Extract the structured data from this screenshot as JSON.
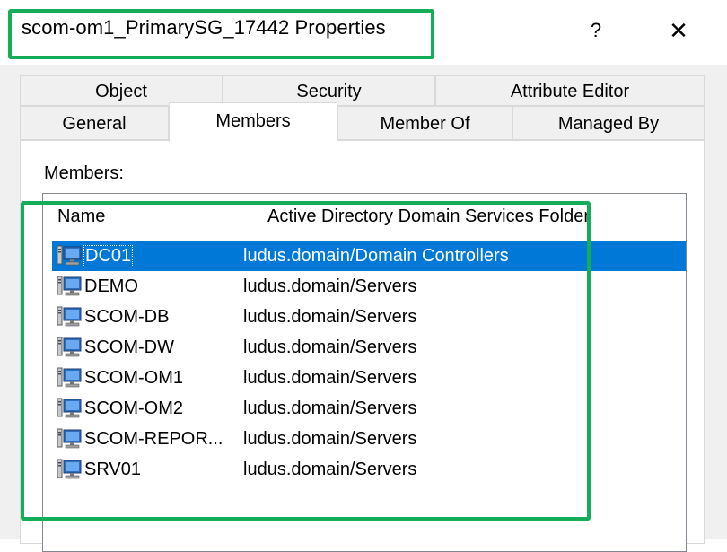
{
  "window": {
    "title": "scom-om1_PrimarySG_17442 Properties",
    "help_label": "?",
    "close_label": "✕"
  },
  "tabs": {
    "object": "Object",
    "security": "Security",
    "attribute_editor": "Attribute Editor",
    "general": "General",
    "members": "Members",
    "member_of": "Member Of",
    "managed_by": "Managed By"
  },
  "members_panel": {
    "label": "Members:",
    "columns": [
      "Name",
      "Active Directory Domain Services Folder"
    ],
    "rows": [
      {
        "name": "DC01",
        "folder": "ludus.domain/Domain Controllers",
        "selected": true
      },
      {
        "name": "DEMO",
        "folder": "ludus.domain/Servers"
      },
      {
        "name": "SCOM-DB",
        "folder": "ludus.domain/Servers"
      },
      {
        "name": "SCOM-DW",
        "folder": "ludus.domain/Servers"
      },
      {
        "name": "SCOM-OM1",
        "folder": "ludus.domain/Servers"
      },
      {
        "name": "SCOM-OM2",
        "folder": "ludus.domain/Servers"
      },
      {
        "name": "SCOM-REPOR...",
        "folder": "ludus.domain/Servers"
      },
      {
        "name": "SRV01",
        "folder": "ludus.domain/Servers"
      }
    ]
  },
  "icons": {
    "row_icon": "computer-icon"
  },
  "colors": {
    "highlight": "#15ad5a",
    "selection": "#0078d7"
  }
}
